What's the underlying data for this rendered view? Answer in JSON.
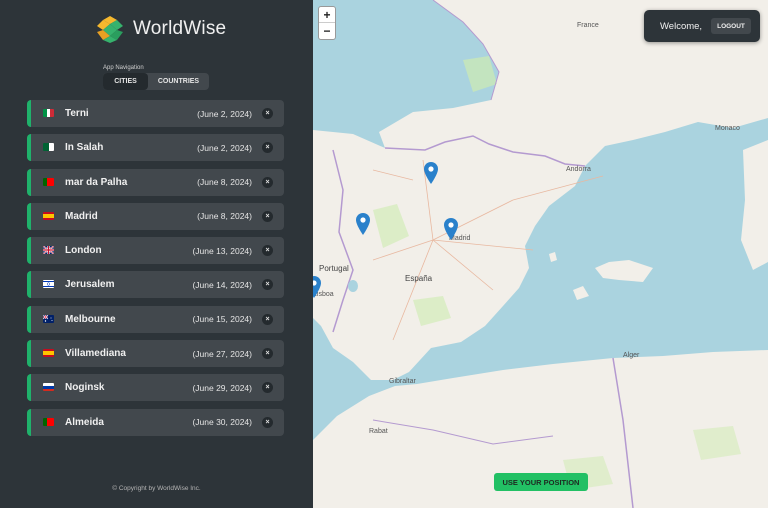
{
  "app": {
    "name": "WorldWise"
  },
  "nav": {
    "label": "App Navigation",
    "tabs": [
      {
        "label": "CITIES",
        "active": true
      },
      {
        "label": "COUNTRIES",
        "active": false
      }
    ]
  },
  "cities": [
    {
      "name": "Terni",
      "date": "(June 2, 2024)",
      "country": "Italy"
    },
    {
      "name": "In Salah",
      "date": "(June 2, 2024)",
      "country": "Algeria"
    },
    {
      "name": "mar da Palha",
      "date": "(June 8, 2024)",
      "country": "Portugal"
    },
    {
      "name": "Madrid",
      "date": "(June 8, 2024)",
      "country": "Spain"
    },
    {
      "name": "London",
      "date": "(June 13, 2024)",
      "country": "United Kingdom"
    },
    {
      "name": "Jerusalem",
      "date": "(June 14, 2024)",
      "country": "Israel"
    },
    {
      "name": "Melbourne",
      "date": "(June 15, 2024)",
      "country": "Australia"
    },
    {
      "name": "Villamediana",
      "date": "(June 27, 2024)",
      "country": "Spain"
    },
    {
      "name": "Noginsk",
      "date": "(June 29, 2024)",
      "country": "Russia"
    },
    {
      "name": "Almeida",
      "date": "(June 30, 2024)",
      "country": "Portugal"
    }
  ],
  "delete_symbol": "×",
  "footer": {
    "copyright": "© Copyright by WorldWise Inc."
  },
  "map": {
    "zoom_in": "+",
    "zoom_out": "−",
    "labels": {
      "france": "France",
      "andorra": "Andorra",
      "monaco": "Monaco",
      "portugal": "Portugal",
      "espana": "España",
      "madrid": "Madrid",
      "lisboa": "Lisboa",
      "gibraltar": "Gibraltar",
      "rabat": "Rabat",
      "alger": "Alger"
    }
  },
  "user": {
    "welcome": "Welcome,",
    "logout": "LOGOUT"
  },
  "actions": {
    "use_position": "USE YOUR POSITION"
  },
  "colors": {
    "accent": "#22c064",
    "sidebar_bg": "#2d3439",
    "item_bg": "#42484d",
    "marker": "#2a81cb"
  }
}
